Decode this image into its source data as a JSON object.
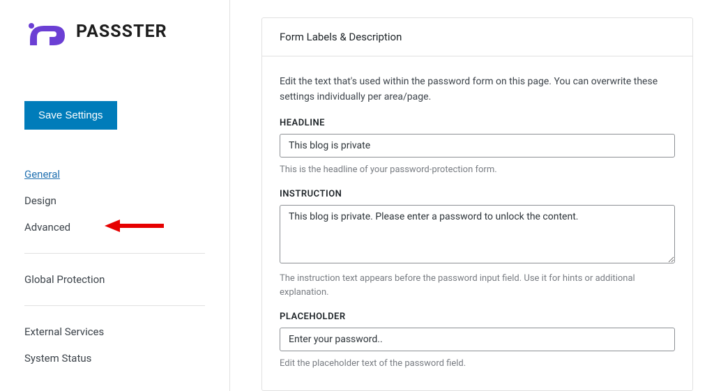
{
  "brand": {
    "name": "PASSSTER"
  },
  "sidebar": {
    "save_label": "Save Settings",
    "items": [
      {
        "label": "General",
        "active": true
      },
      {
        "label": "Design",
        "active": false
      },
      {
        "label": "Advanced",
        "active": false
      }
    ],
    "group2": [
      {
        "label": "Global Protection"
      }
    ],
    "group3": [
      {
        "label": "External Services"
      },
      {
        "label": "System Status"
      }
    ]
  },
  "main": {
    "card_title": "Form Labels & Description",
    "intro_text": "Edit the text that's used within the password form on this page. You can overwrite these settings individually per area/page.",
    "headline": {
      "label": "HEADLINE",
      "value": "This blog is private",
      "help": "This is the headline of your password-protection form."
    },
    "instruction": {
      "label": "INSTRUCTION",
      "value": "This blog is private. Please enter a password to unlock the content.",
      "help": "The instruction text appears before the password input field. Use it for hints or additional explanation."
    },
    "placeholder": {
      "label": "PLACEHOLDER",
      "value": "Enter your password..",
      "help": "Edit the placeholder text of the password field."
    }
  }
}
